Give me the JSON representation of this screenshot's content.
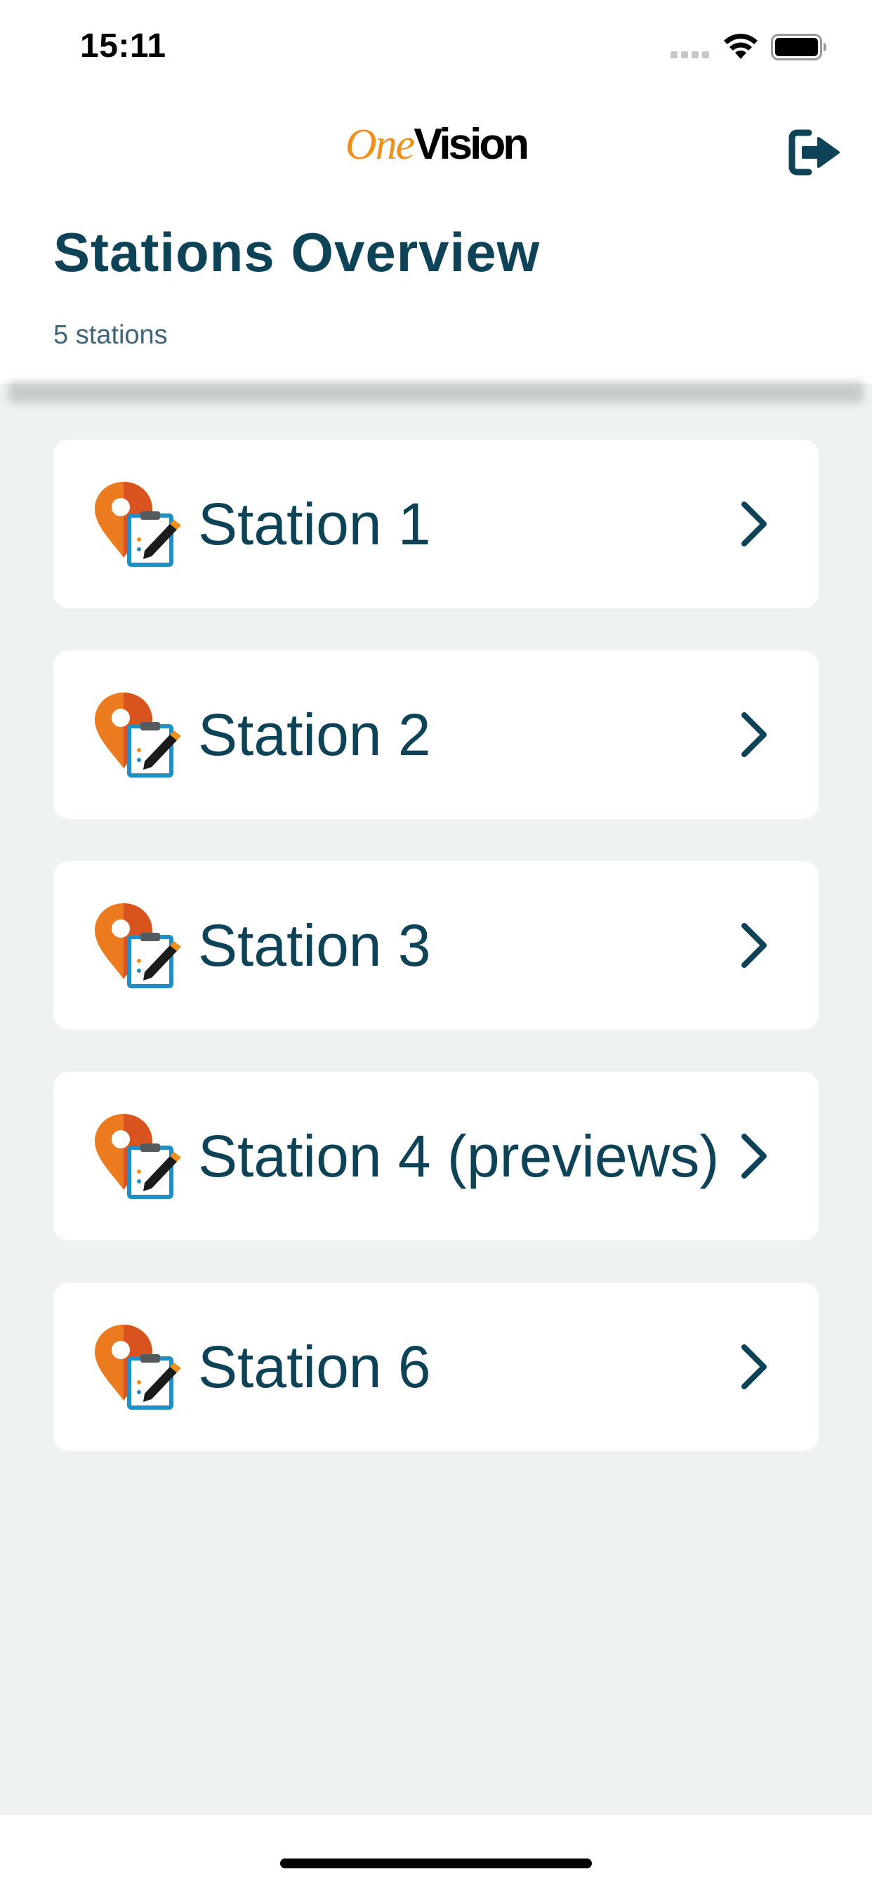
{
  "status_bar": {
    "time": "15:11"
  },
  "header": {
    "logo": {
      "part1": "One",
      "part2": "Vision"
    },
    "logout_icon": "logout-icon"
  },
  "page": {
    "title": "Stations Overview",
    "count_label": "5 stations"
  },
  "stations": [
    {
      "label": "Station 1"
    },
    {
      "label": "Station 2"
    },
    {
      "label": "Station 3"
    },
    {
      "label": "Station 4 (previews)"
    },
    {
      "label": "Station 6"
    }
  ],
  "colors": {
    "primary": "#0d4257",
    "accent_orange": "#f0901a",
    "list_background": "#eff2f3",
    "card_background": "#ffffff"
  }
}
